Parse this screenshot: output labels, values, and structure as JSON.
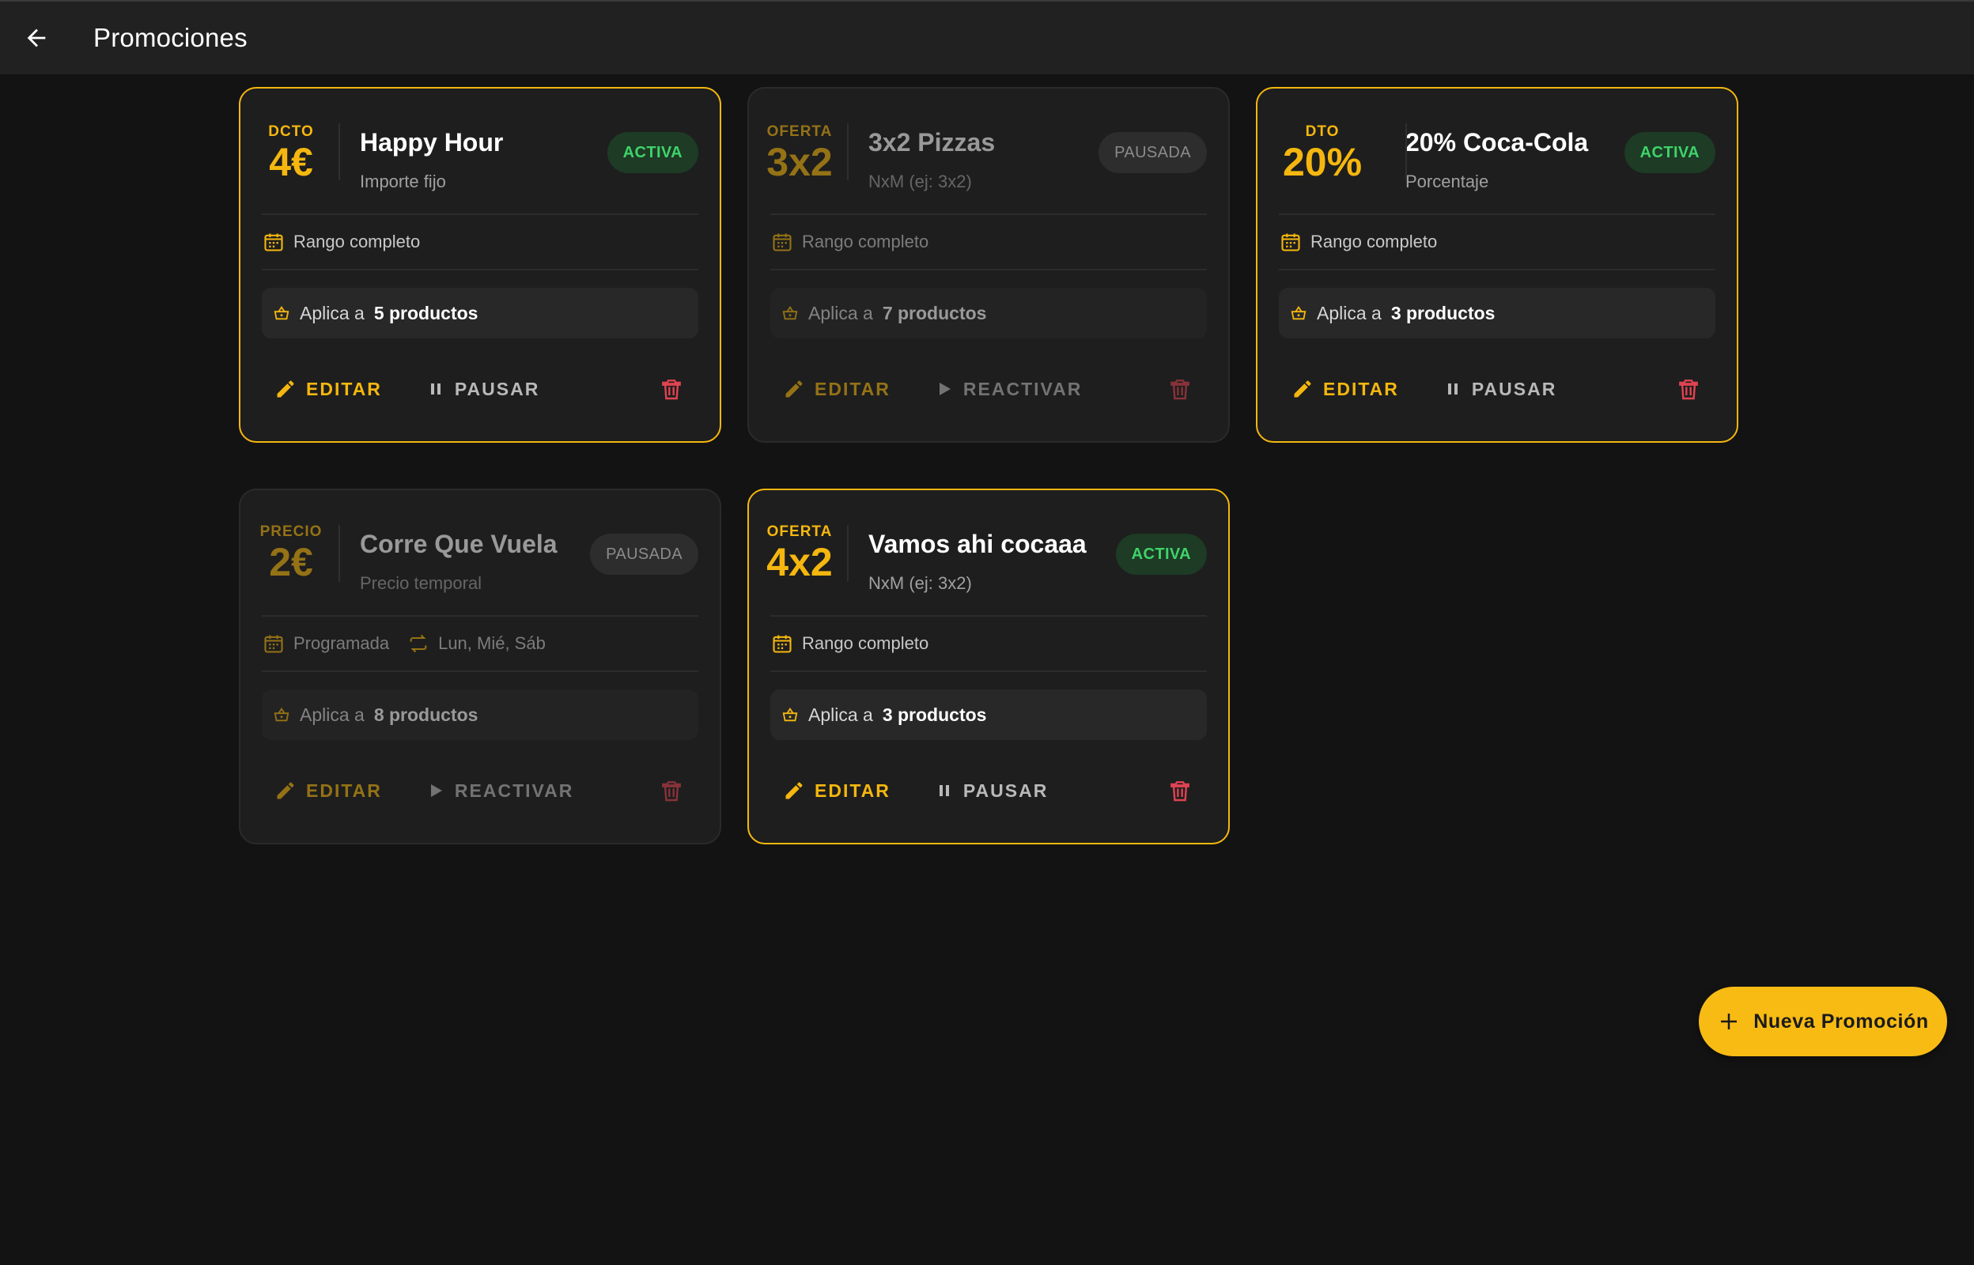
{
  "appbar": {
    "title": "Promociones"
  },
  "colors": {
    "accent": "#f5b70f",
    "active_green": "#3fd36a",
    "danger_red": "#e04352",
    "background": "#131313"
  },
  "promotions": [
    {
      "badge_kind": "DCTO",
      "badge_value": "4€",
      "title": "Happy Hour",
      "subtitle": "Importe fijo",
      "status": "ACTIVA",
      "active": true,
      "schedule": "Rango completo",
      "days": "",
      "applies_prefix": "Aplica a",
      "applies_count": "5 productos",
      "edit_label": "EDITAR",
      "toggle_label": "PAUSAR"
    },
    {
      "badge_kind": "OFERTA",
      "badge_value": "3x2",
      "title": "3x2 Pizzas",
      "subtitle": "NxM (ej: 3x2)",
      "status": "PAUSADA",
      "active": false,
      "schedule": "Rango completo",
      "days": "",
      "applies_prefix": "Aplica a",
      "applies_count": "7 productos",
      "edit_label": "EDITAR",
      "toggle_label": "REACTIVAR"
    },
    {
      "badge_kind": "DTO",
      "badge_value": "20%",
      "title": "20% Coca-Cola",
      "subtitle": "Porcentaje",
      "status": "ACTIVA",
      "active": true,
      "schedule": "Rango completo",
      "days": "",
      "applies_prefix": "Aplica a",
      "applies_count": "3 productos",
      "edit_label": "EDITAR",
      "toggle_label": "PAUSAR"
    },
    {
      "badge_kind": "PRECIO",
      "badge_value": "2€",
      "title": "Corre Que Vuela",
      "subtitle": "Precio temporal",
      "status": "PAUSADA",
      "active": false,
      "schedule": "Programada",
      "days": "Lun, Mié, Sáb",
      "applies_prefix": "Aplica a",
      "applies_count": "8 productos",
      "edit_label": "EDITAR",
      "toggle_label": "REACTIVAR"
    },
    {
      "badge_kind": "OFERTA",
      "badge_value": "4x2",
      "title": "Vamos ahi cocaaa",
      "subtitle": "NxM (ej: 3x2)",
      "status": "ACTIVA",
      "active": true,
      "schedule": "Rango completo",
      "days": "",
      "applies_prefix": "Aplica a",
      "applies_count": "3 productos",
      "edit_label": "EDITAR",
      "toggle_label": "PAUSAR"
    }
  ],
  "fab": {
    "label": "Nueva Promoción"
  },
  "icons": {
    "back": "arrow-left-icon",
    "calendar": "calendar-icon",
    "repeat": "repeat-icon",
    "basket": "basket-icon",
    "edit": "pencil-icon",
    "pause": "pause-icon",
    "play": "play-icon",
    "delete": "trash-icon",
    "add": "plus-icon"
  }
}
